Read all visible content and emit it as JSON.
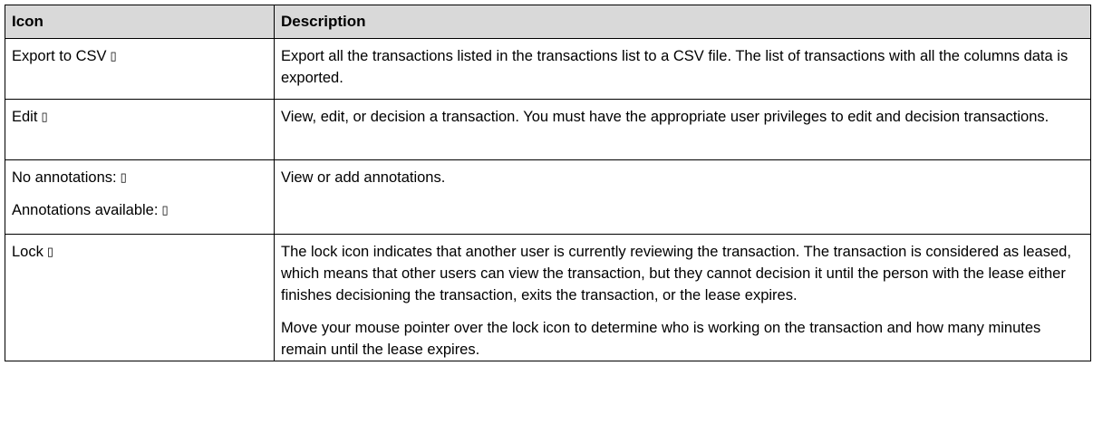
{
  "table": {
    "headers": [
      "Icon",
      "Description"
    ],
    "rows": [
      {
        "icon_lines": [
          {
            "label": "Export to CSV",
            "glyph": "▯"
          }
        ],
        "description": [
          "Export all the transactions listed in the transactions list to a CSV file. The list of transactions with all the columns data is exported."
        ]
      },
      {
        "icon_lines": [
          {
            "label": "Edit",
            "glyph": "▯"
          }
        ],
        "description": [
          "View, edit, or decision a transaction. You must have the appropriate user privileges to edit and decision transactions."
        ]
      },
      {
        "icon_lines": [
          {
            "label": "No annotations:",
            "glyph": "▯"
          },
          {
            "label": "Annotations available:",
            "glyph": "▯"
          }
        ],
        "description": [
          "View or add annotations."
        ]
      },
      {
        "icon_lines": [
          {
            "label": "Lock",
            "glyph": "▯"
          }
        ],
        "description": [
          "The lock icon indicates that another user is currently reviewing the transaction. The transaction is considered as leased, which means that other users can view the transaction, but they cannot decision it until the person with the lease either finishes decisioning the transaction, exits the transaction, or the lease expires.",
          "Move your mouse pointer over the lock icon to determine who is working on the transaction and how many minutes remain until the lease expires."
        ]
      }
    ]
  }
}
